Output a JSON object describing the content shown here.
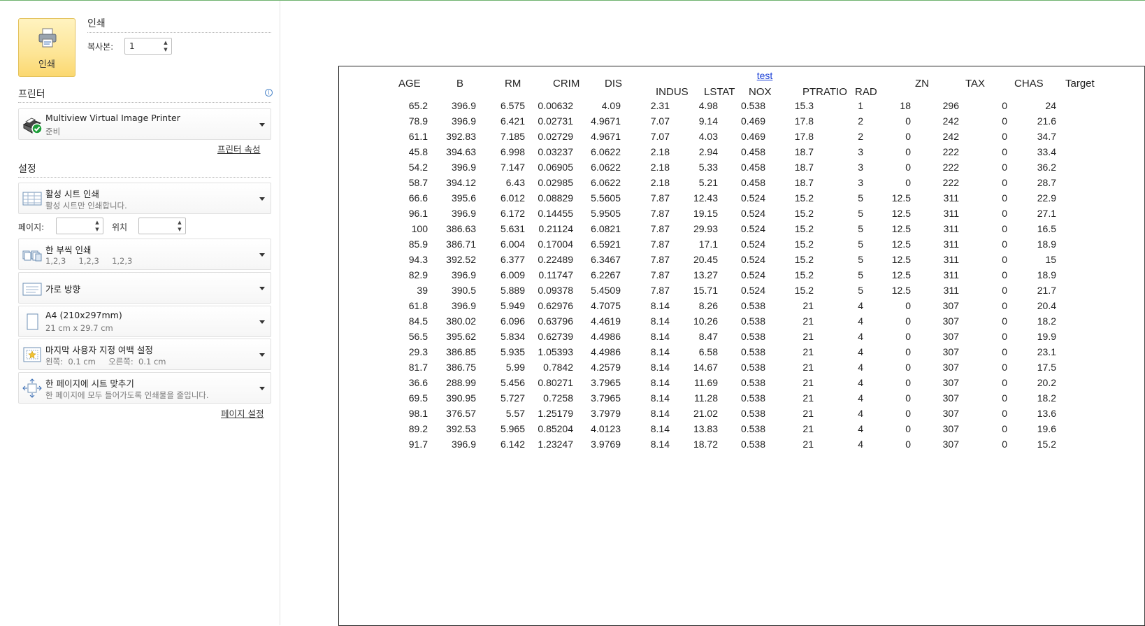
{
  "print_section": {
    "print_button_label": "인쇄",
    "title": "인쇄",
    "copies_label": "복사본:",
    "copies_value": "1"
  },
  "printer": {
    "section_title": "프린터",
    "name": "Multiview Virtual Image Printer",
    "status": "준비",
    "properties_link": "프린터 속성"
  },
  "settings": {
    "section_title": "설정",
    "what_to_print": {
      "title": "활성 시트 인쇄",
      "subtitle": "활성 시트만 인쇄합니다."
    },
    "pages_label": "페이지:",
    "pages_value": "",
    "to_label": "위치",
    "to_value": "",
    "collate": {
      "title": "한 부씩 인쇄",
      "subtitle": "1,2,3     1,2,3     1,2,3"
    },
    "orientation": {
      "title": "가로 방향"
    },
    "paper": {
      "title": "A4 (210x297mm)",
      "subtitle": "21 cm x 29.7 cm"
    },
    "margins": {
      "title": "마지막 사용자 지정 여백 설정",
      "subtitle": "왼쪽:  0.1 cm     오른쪽:  0.1 cm"
    },
    "scaling": {
      "title": "한 페이지에 시트 맞추기",
      "subtitle": "한 페이지에 모두 들어가도록 인쇄물을 줄입니다."
    },
    "page_setup_link": "페이지 설정"
  },
  "preview": {
    "link_header": "test",
    "headers": [
      "AGE",
      "B",
      "RM",
      "CRIM",
      "DIS",
      "INDUS",
      "LSTAT",
      "NOX",
      "PTRATIO",
      "RAD",
      "ZN",
      "TAX",
      "CHAS",
      "Target"
    ],
    "rows": [
      [
        "65.2",
        "396.9",
        "6.575",
        "0.00632",
        "4.09",
        "2.31",
        "4.98",
        "0.538",
        "15.3",
        "1",
        "18",
        "296",
        "0",
        "24"
      ],
      [
        "78.9",
        "396.9",
        "6.421",
        "0.02731",
        "4.9671",
        "7.07",
        "9.14",
        "0.469",
        "17.8",
        "2",
        "0",
        "242",
        "0",
        "21.6"
      ],
      [
        "61.1",
        "392.83",
        "7.185",
        "0.02729",
        "4.9671",
        "7.07",
        "4.03",
        "0.469",
        "17.8",
        "2",
        "0",
        "242",
        "0",
        "34.7"
      ],
      [
        "45.8",
        "394.63",
        "6.998",
        "0.03237",
        "6.0622",
        "2.18",
        "2.94",
        "0.458",
        "18.7",
        "3",
        "0",
        "222",
        "0",
        "33.4"
      ],
      [
        "54.2",
        "396.9",
        "7.147",
        "0.06905",
        "6.0622",
        "2.18",
        "5.33",
        "0.458",
        "18.7",
        "3",
        "0",
        "222",
        "0",
        "36.2"
      ],
      [
        "58.7",
        "394.12",
        "6.43",
        "0.02985",
        "6.0622",
        "2.18",
        "5.21",
        "0.458",
        "18.7",
        "3",
        "0",
        "222",
        "0",
        "28.7"
      ],
      [
        "66.6",
        "395.6",
        "6.012",
        "0.08829",
        "5.5605",
        "7.87",
        "12.43",
        "0.524",
        "15.2",
        "5",
        "12.5",
        "311",
        "0",
        "22.9"
      ],
      [
        "96.1",
        "396.9",
        "6.172",
        "0.14455",
        "5.9505",
        "7.87",
        "19.15",
        "0.524",
        "15.2",
        "5",
        "12.5",
        "311",
        "0",
        "27.1"
      ],
      [
        "100",
        "386.63",
        "5.631",
        "0.21124",
        "6.0821",
        "7.87",
        "29.93",
        "0.524",
        "15.2",
        "5",
        "12.5",
        "311",
        "0",
        "16.5"
      ],
      [
        "85.9",
        "386.71",
        "6.004",
        "0.17004",
        "6.5921",
        "7.87",
        "17.1",
        "0.524",
        "15.2",
        "5",
        "12.5",
        "311",
        "0",
        "18.9"
      ],
      [
        "94.3",
        "392.52",
        "6.377",
        "0.22489",
        "6.3467",
        "7.87",
        "20.45",
        "0.524",
        "15.2",
        "5",
        "12.5",
        "311",
        "0",
        "15"
      ],
      [
        "82.9",
        "396.9",
        "6.009",
        "0.11747",
        "6.2267",
        "7.87",
        "13.27",
        "0.524",
        "15.2",
        "5",
        "12.5",
        "311",
        "0",
        "18.9"
      ],
      [
        "39",
        "390.5",
        "5.889",
        "0.09378",
        "5.4509",
        "7.87",
        "15.71",
        "0.524",
        "15.2",
        "5",
        "12.5",
        "311",
        "0",
        "21.7"
      ],
      [
        "61.8",
        "396.9",
        "5.949",
        "0.62976",
        "4.7075",
        "8.14",
        "8.26",
        "0.538",
        "21",
        "4",
        "0",
        "307",
        "0",
        "20.4"
      ],
      [
        "84.5",
        "380.02",
        "6.096",
        "0.63796",
        "4.4619",
        "8.14",
        "10.26",
        "0.538",
        "21",
        "4",
        "0",
        "307",
        "0",
        "18.2"
      ],
      [
        "56.5",
        "395.62",
        "5.834",
        "0.62739",
        "4.4986",
        "8.14",
        "8.47",
        "0.538",
        "21",
        "4",
        "0",
        "307",
        "0",
        "19.9"
      ],
      [
        "29.3",
        "386.85",
        "5.935",
        "1.05393",
        "4.4986",
        "8.14",
        "6.58",
        "0.538",
        "21",
        "4",
        "0",
        "307",
        "0",
        "23.1"
      ],
      [
        "81.7",
        "386.75",
        "5.99",
        "0.7842",
        "4.2579",
        "8.14",
        "14.67",
        "0.538",
        "21",
        "4",
        "0",
        "307",
        "0",
        "17.5"
      ],
      [
        "36.6",
        "288.99",
        "5.456",
        "0.80271",
        "3.7965",
        "8.14",
        "11.69",
        "0.538",
        "21",
        "4",
        "0",
        "307",
        "0",
        "20.2"
      ],
      [
        "69.5",
        "390.95",
        "5.727",
        "0.7258",
        "3.7965",
        "8.14",
        "11.28",
        "0.538",
        "21",
        "4",
        "0",
        "307",
        "0",
        "18.2"
      ],
      [
        "98.1",
        "376.57",
        "5.57",
        "1.25179",
        "3.7979",
        "8.14",
        "21.02",
        "0.538",
        "21",
        "4",
        "0",
        "307",
        "0",
        "13.6"
      ],
      [
        "89.2",
        "392.53",
        "5.965",
        "0.85204",
        "4.0123",
        "8.14",
        "13.83",
        "0.538",
        "21",
        "4",
        "0",
        "307",
        "0",
        "19.6"
      ],
      [
        "91.7",
        "396.9",
        "6.142",
        "1.23247",
        "3.9769",
        "8.14",
        "18.72",
        "0.538",
        "21",
        "4",
        "0",
        "307",
        "0",
        "15.2"
      ]
    ]
  },
  "colors": {
    "print_button_bg": "#fde596",
    "link_blue": "#1a3fd6",
    "ready_green": "#1e9e3a"
  },
  "icons": [
    "printer-icon",
    "printer-ready-icon",
    "info-icon",
    "sheet-icon",
    "collate-icon",
    "landscape-icon",
    "paper-icon",
    "margins-icon",
    "fit-page-icon"
  ]
}
